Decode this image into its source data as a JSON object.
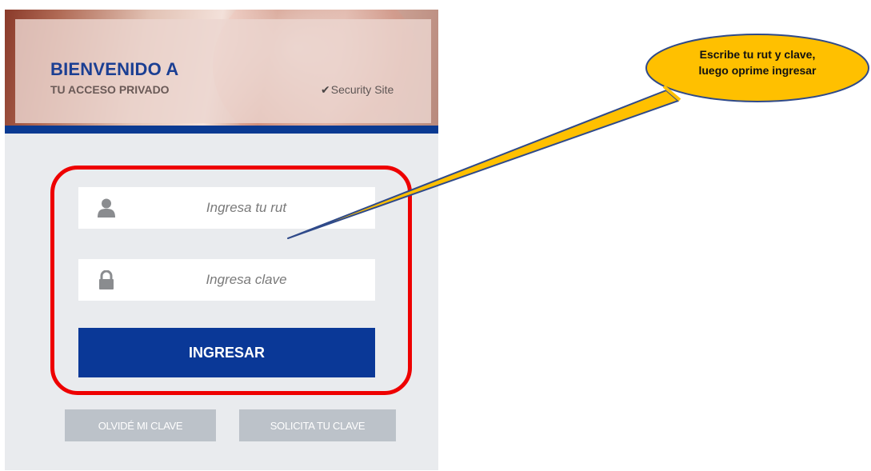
{
  "header": {
    "title": "BIENVENIDO A",
    "subtitle": "TU ACCESO PRIVADO",
    "security_check": "✔",
    "security_label": "Security Site"
  },
  "login": {
    "rut_placeholder": "Ingresa tu rut",
    "rut_value": "",
    "rut_icon": "user-icon",
    "password_placeholder": "Ingresa clave",
    "password_value": "",
    "password_icon": "lock-icon",
    "submit_label": "INGRESAR",
    "forgot_label": "OLVIDÉ MI CLAVE",
    "request_label": "SOLICITA TU CLAVE"
  },
  "annotation": {
    "line1": "Escribe tu rut y clave,",
    "line2": "luego oprime ingresar",
    "callout_color": "#ffc000",
    "highlight_color": "#ee0000"
  },
  "colors": {
    "brand_blue": "#0a3897",
    "panel_bg": "#e9ebee",
    "secondary_button": "#bcc2c9"
  }
}
